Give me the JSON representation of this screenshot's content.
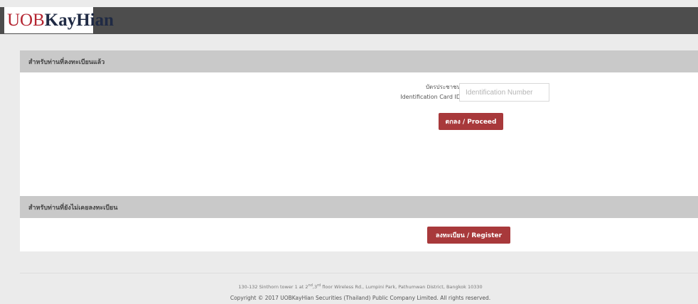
{
  "header": {
    "logo_uob": "UOB",
    "logo_kayhian": "KayHian"
  },
  "registered": {
    "title": "สำหรับท่านที่ลงทะเบียนแล้ว",
    "id_label_th": "บัตรประชาชน",
    "id_label_en": "Identification Card ID",
    "id_placeholder": "Identification Number",
    "id_value": "",
    "proceed_label": "ตกลง / Proceed"
  },
  "not_registered": {
    "title": "สำหรับท่านที่ยังไม่เคยลงทะเบียน",
    "register_label": "ลงทะเบียน / Register"
  },
  "footer": {
    "address_part1": "130-132 Sinthorn tower 1 at 2",
    "address_sup1": "nd",
    "address_part2": ",3",
    "address_sup2": "rd",
    "address_part3": " floor Wireless Rd., Lumpini Park, Pathumwan District, Bangkok 10330",
    "copyright": "Copyright © 2017 UOBKayHian Securities (Thailand) Public Company Limited. All rights reserved."
  },
  "colors": {
    "topbar": "#4d4d4d",
    "brand_red": "#b42531",
    "button": "#a8393b",
    "section_header": "#c9c9c9"
  }
}
